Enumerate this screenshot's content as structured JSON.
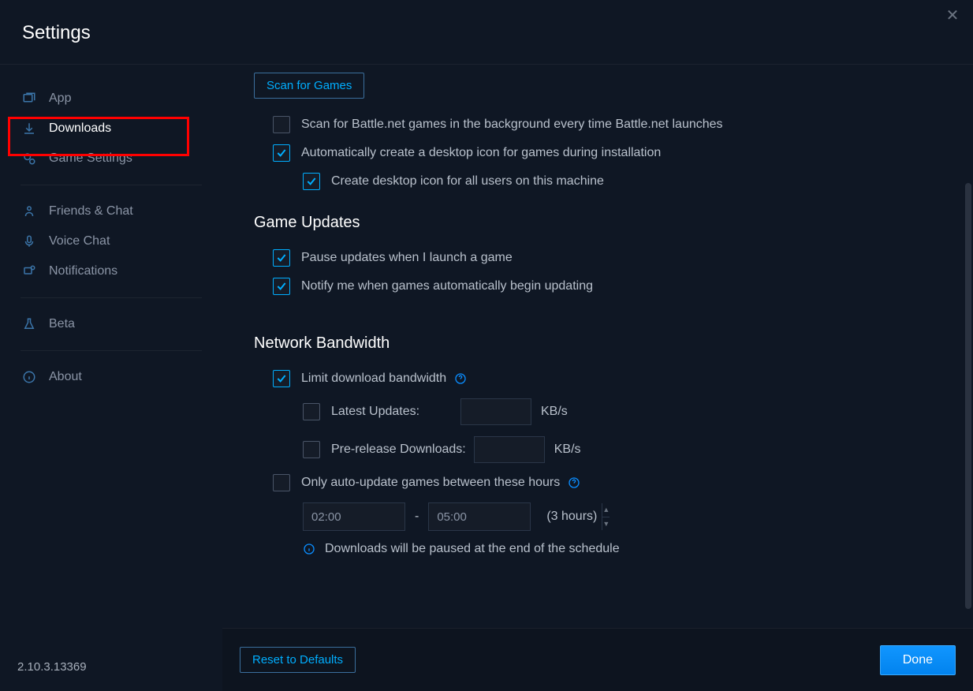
{
  "header": {
    "title": "Settings"
  },
  "sidebar": {
    "items": [
      {
        "label": "App"
      },
      {
        "label": "Downloads"
      },
      {
        "label": "Game Settings"
      },
      {
        "label": "Friends & Chat"
      },
      {
        "label": "Voice Chat"
      },
      {
        "label": "Notifications"
      },
      {
        "label": "Beta"
      },
      {
        "label": "About"
      }
    ],
    "version": "2.10.3.13369"
  },
  "scan": {
    "button": "Scan for Games",
    "background": "Scan for Battle.net games in the background every time Battle.net launches",
    "desktopIcon": "Automatically create a desktop icon for games during installation",
    "allUsers": "Create desktop icon for all users on this machine"
  },
  "updates": {
    "title": "Game Updates",
    "pause": "Pause updates when I launch a game",
    "notify": "Notify me when games automatically begin updating"
  },
  "bandwidth": {
    "title": "Network Bandwidth",
    "limit": "Limit download bandwidth",
    "latest": "Latest Updates:",
    "prerelease": "Pre-release Downloads:",
    "unit": "KB/s",
    "autoupdate": "Only auto-update games between these hours",
    "timeFrom": "02:00",
    "timeTo": "05:00",
    "hoursNote": "(3 hours)",
    "pauseNote": "Downloads will be paused at the end of the schedule"
  },
  "footer": {
    "reset": "Reset to Defaults",
    "done": "Done"
  }
}
